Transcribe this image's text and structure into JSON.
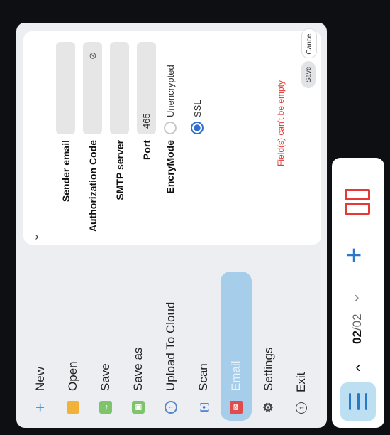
{
  "menu": {
    "items": [
      {
        "label": "New",
        "icon": "plus-icon"
      },
      {
        "label": "Open",
        "icon": "open-folder-icon"
      },
      {
        "label": "Save",
        "icon": "save-icon"
      },
      {
        "label": "Save as",
        "icon": "save-as-icon"
      },
      {
        "label": "Upload To Cloud",
        "icon": "cloud-upload-icon"
      },
      {
        "label": "Scan",
        "icon": "scan-icon"
      },
      {
        "label": "Email",
        "icon": "email-icon",
        "active": true
      },
      {
        "label": "Settings",
        "icon": "gear-icon"
      },
      {
        "label": "Exit",
        "icon": "exit-icon"
      }
    ]
  },
  "email_form": {
    "sender_email_label": "Sender email",
    "sender_email_value": "",
    "authorization_code_label": "Authorization Code",
    "authorization_code_value": "",
    "smtp_server_label": "SMTP server",
    "smtp_server_value": "",
    "port_label": "Port",
    "port_value": "465",
    "encry_mode_label": "EncryMode",
    "mode_unencrypted": "Unencrypted",
    "mode_ssl": "SSL",
    "selected_mode": "SSL",
    "error_text": "Field(s) can't be empty",
    "save_label": "Save",
    "cancel_label": "Cancel"
  },
  "toolbar": {
    "page_current": "02",
    "page_total": "/02"
  },
  "colors": {
    "accent": "#2b78c9",
    "active_menu_bg": "#a6cdea",
    "error": "#e53935"
  }
}
